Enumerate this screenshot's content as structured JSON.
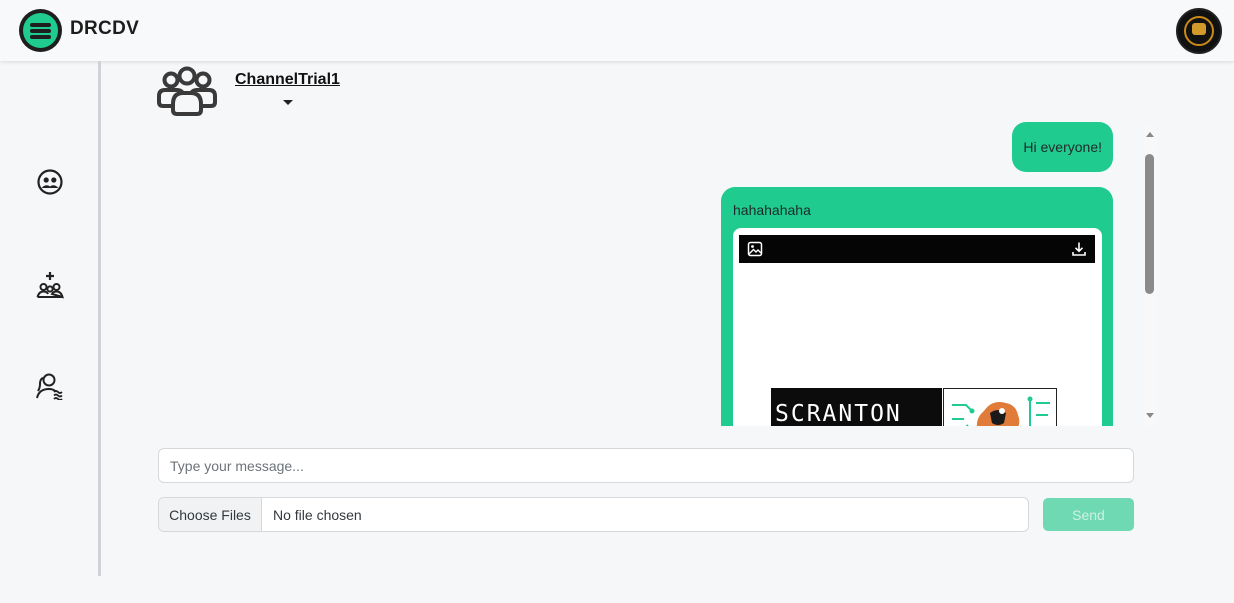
{
  "app": {
    "brand": "DRCDV"
  },
  "header": {
    "avatar_icon": "user-avatar"
  },
  "sidebar": {
    "items": [
      {
        "icon": "team-icon"
      },
      {
        "icon": "add-group-icon"
      },
      {
        "icon": "user-list-icon"
      }
    ]
  },
  "channel": {
    "name": "ChannelTrial1",
    "icon": "group-icon"
  },
  "messages": [
    {
      "text": "Hi everyone!"
    },
    {
      "text": "hahahahaha",
      "attachment": {
        "image_text": "SCRANTON",
        "icons": [
          "image-icon",
          "download-icon"
        ]
      }
    }
  ],
  "composer": {
    "message_placeholder": "Type your message...",
    "file_button_label": "Choose Files",
    "file_status": "No file chosen",
    "send_label": "Send"
  },
  "colors": {
    "accent": "#1fcb8f",
    "send_disabled": "#6fd9b3",
    "background": "#f6f7f9"
  }
}
